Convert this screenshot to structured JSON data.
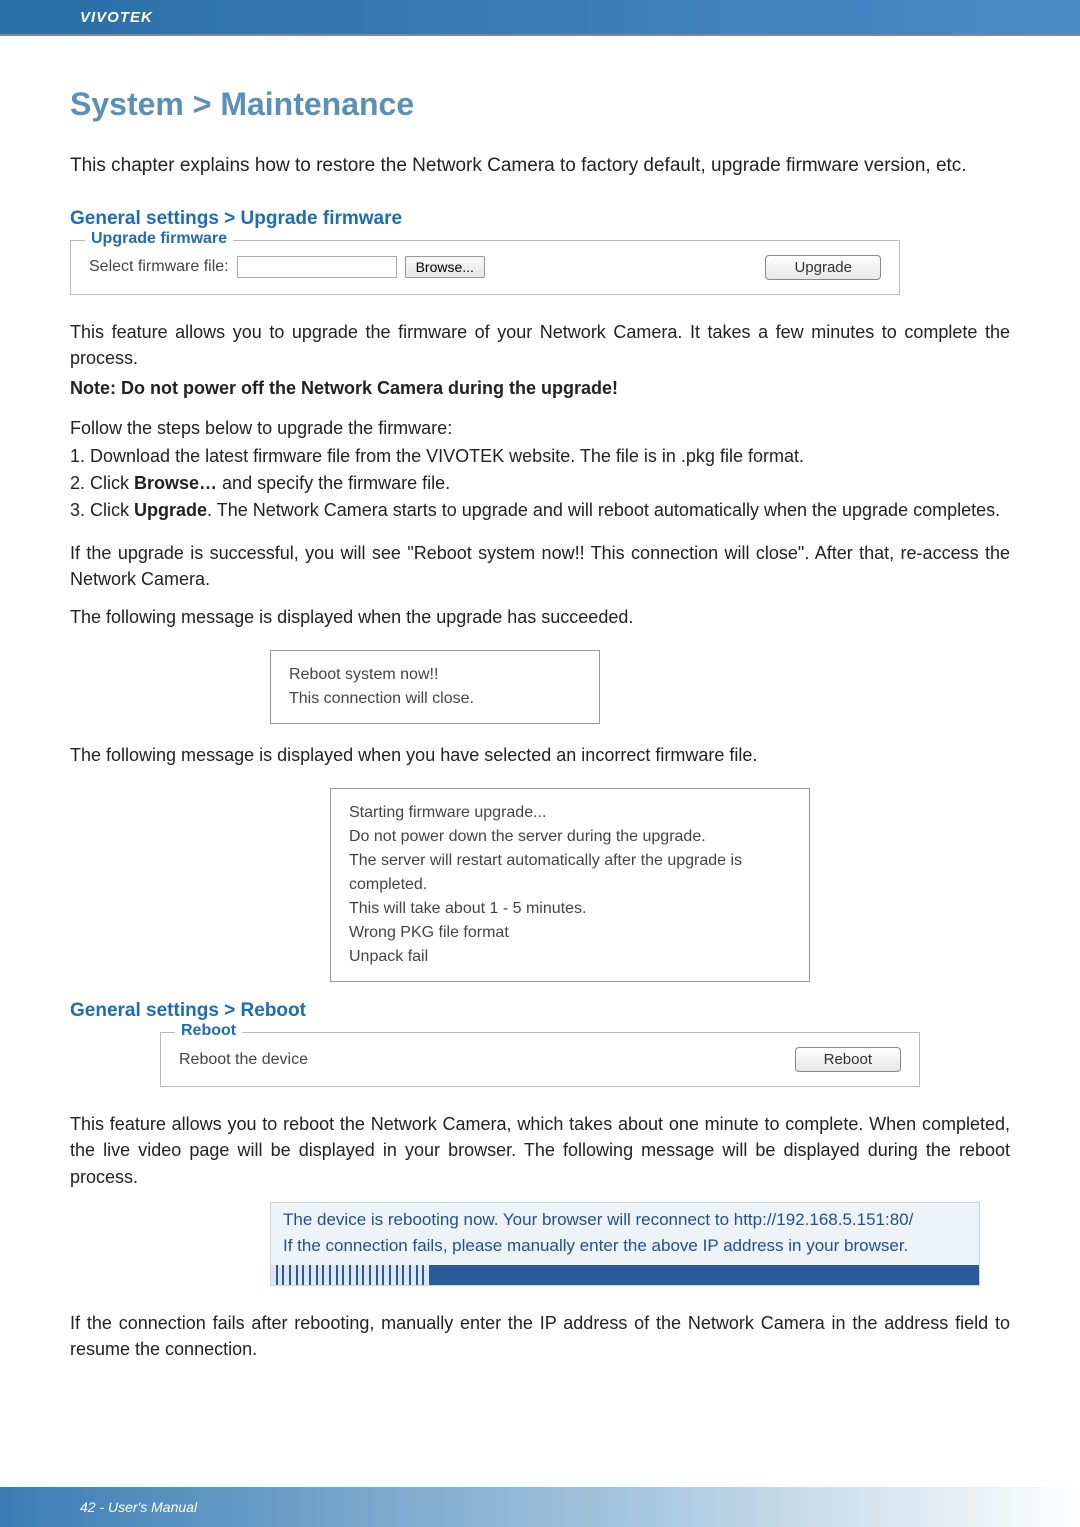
{
  "brand": "VIVOTEK",
  "page_title": "System > Maintenance",
  "intro": "This chapter explains how to restore the Network Camera to factory default, upgrade firmware version, etc.",
  "upgrade": {
    "section_heading": "General settings > Upgrade firmware",
    "legend": "Upgrade firmware",
    "label": "Select firmware file:",
    "browse_btn": "Browse...",
    "upgrade_btn": "Upgrade"
  },
  "upgrade_desc": {
    "p1": "This feature allows you to upgrade the firmware of your Network Camera. It takes a few minutes to complete the process.",
    "note": "Note: Do not power off the Network Camera during the upgrade!",
    "steps_intro": "Follow the steps below to upgrade the firmware:",
    "step1": "1. Download the latest firmware file from the VIVOTEK website. The file is in .pkg file format.",
    "step2_a": "2. Click ",
    "step2_bold": "Browse…",
    "step2_b": " and specify the firmware file.",
    "step3_a": "3. Click ",
    "step3_bold": "Upgrade",
    "step3_b": ". The Network Camera starts to upgrade and will reboot automatically when the upgrade completes.",
    "success": "If the upgrade is successful, you will see \"Reboot system now!! This connection will close\". After that, re-access the Network Camera.",
    "msg1_intro": "The following message is displayed when the upgrade has succeeded.",
    "msg1_l1": "Reboot system now!!",
    "msg1_l2": "This connection will close.",
    "msg2_intro": "The following message is displayed when you have selected an incorrect firmware file.",
    "msg2_l1": "Starting firmware upgrade...",
    "msg2_l2": "Do not power down the server during the upgrade.",
    "msg2_l3": "The server will restart automatically after the upgrade is completed.",
    "msg2_l4": "This will take about 1 - 5 minutes.",
    "msg2_l5": "Wrong PKG file format",
    "msg2_l6": "Unpack fail"
  },
  "reboot": {
    "section_heading": "General settings > Reboot",
    "legend": "Reboot",
    "label": "Reboot the device",
    "btn": "Reboot",
    "desc": "This feature allows you to reboot the Network Camera, which takes about one minute to complete. When completed, the live video page will be displayed in your browser. The following message will be displayed during the reboot process.",
    "msg_l1": "The device is rebooting now. Your browser will reconnect to http://192.168.5.151:80/",
    "msg_l2": "If the connection fails, please manually enter the above IP address in your browser.",
    "after": "If the connection fails after rebooting, manually enter the IP address of the Network Camera in the address field to resume the connection."
  },
  "footer": "42 - User's Manual"
}
